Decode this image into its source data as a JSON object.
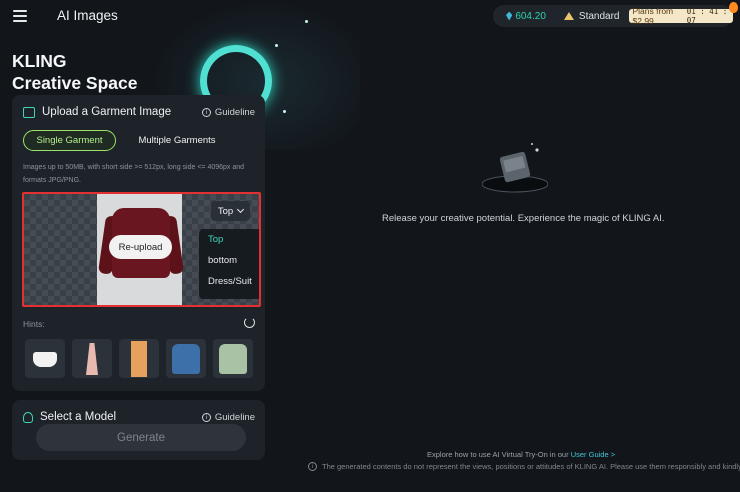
{
  "header": {
    "app_title": "AI Images",
    "credits": "604.20",
    "tier": "Standard",
    "plans_text": "Plans from $2.99",
    "plans_timer": "01 : 41 : 07"
  },
  "hero": {
    "title_line1": "KLING",
    "title_line2": "Creative Space"
  },
  "upload_panel": {
    "title": "Upload a Garment Image",
    "guideline": "Guideline",
    "tabs": [
      {
        "label": "Single Garment",
        "active": true
      },
      {
        "label": "Multiple Garments",
        "active": false
      }
    ],
    "requirements": "Images up to 50MB, with short side >= 512px, long side <= 4096px and formats JPG/PNG.",
    "reupload_label": "Re-upload",
    "type_selected": "Top",
    "type_options": [
      "Top",
      "bottom",
      "Dress/Suit"
    ],
    "hints_label": "Hints:"
  },
  "model_panel": {
    "title": "Select a Model",
    "guideline": "Guideline"
  },
  "generate_label": "Generate",
  "main": {
    "empty_message": "Release your creative potential. Experience the magic of KLING AI.",
    "explore_prefix": "Explore how to use AI Virtual Try-On in our",
    "user_guide": "User Guide >",
    "disclaimer": "The generated contents do not represent the views, positions or attitudes of KLING AI. Please use them responsibly and kindly."
  },
  "colors": {
    "accent": "#3fd7b8",
    "active_tab": "#9be36a",
    "highlight_border": "#e43030",
    "background": "#12161b"
  }
}
